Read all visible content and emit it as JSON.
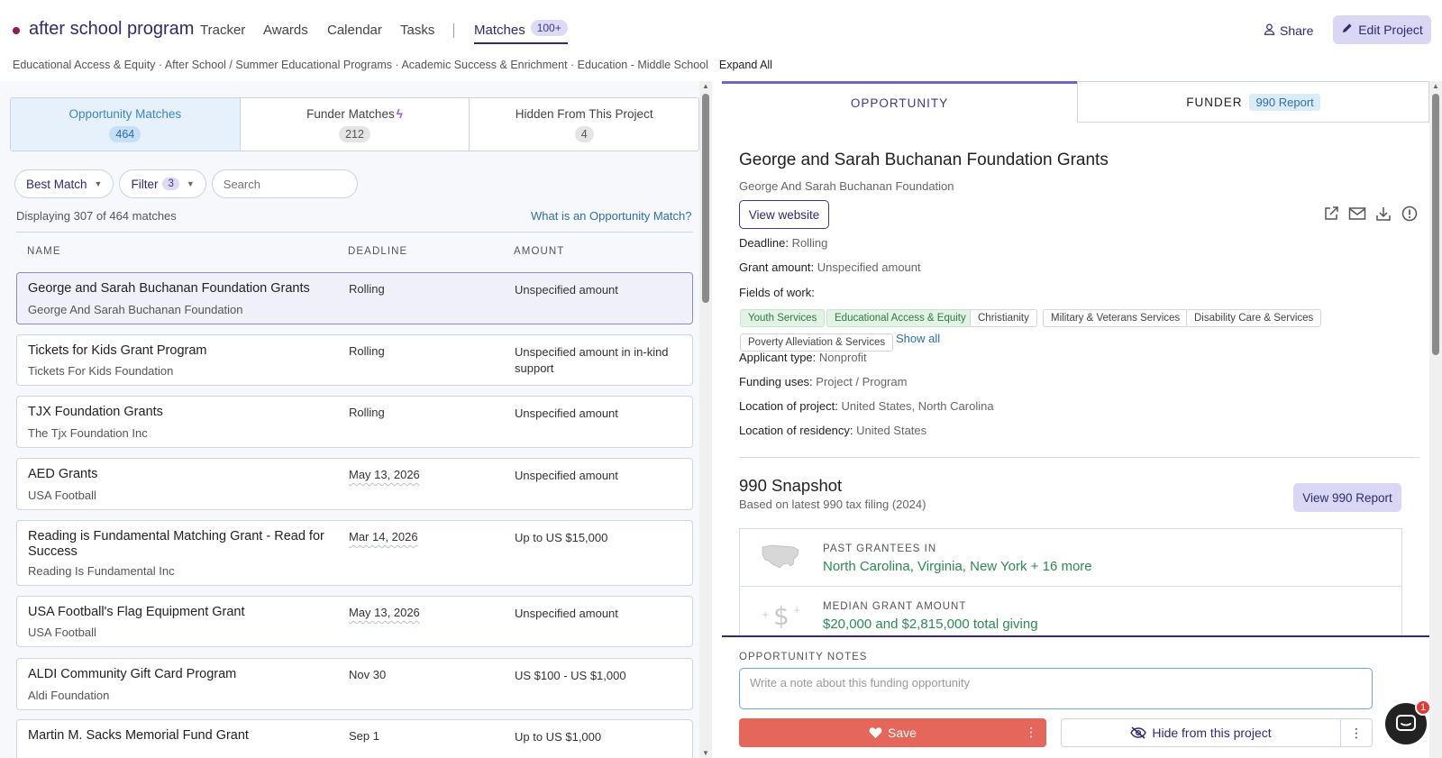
{
  "project": {
    "title": "after school program",
    "dot_color": "#8e1c55"
  },
  "nav": {
    "items": [
      "Tracker",
      "Awards",
      "Calendar",
      "Tasks"
    ],
    "active": {
      "label": "Matches",
      "badge": "100+"
    },
    "share_label": "Share",
    "edit_label": "Edit Project"
  },
  "breadcrumb": {
    "text": "Educational Access & Equity · After School / Summer Educational Programs · Academic Success & Enrichment · Education - Middle School",
    "expand_label": "Expand All"
  },
  "tabs": [
    {
      "label": "Opportunity Matches",
      "count": "464"
    },
    {
      "label": "Funder Matches",
      "count": "212"
    },
    {
      "label": "Hidden From This Project",
      "count": "4"
    }
  ],
  "controls": {
    "sort_label": "Best Match",
    "filter_label": "Filter",
    "filter_count": "3",
    "search_placeholder": "Search"
  },
  "list": {
    "display_text": "Displaying 307 of 464 matches",
    "what_link": "What is an Opportunity Match?",
    "headers": {
      "name": "NAME",
      "deadline": "DEADLINE",
      "amount": "AMOUNT"
    },
    "rows": [
      {
        "name": "George and Sarah Buchanan Foundation Grants",
        "funder": "George And Sarah Buchanan Foundation",
        "deadline": "Rolling",
        "amount": "Unspecified amount"
      },
      {
        "name": "Tickets for Kids Grant Program",
        "funder": "Tickets For Kids Foundation",
        "deadline": "Rolling",
        "amount": "Unspecified amount in in-kind support"
      },
      {
        "name": "TJX Foundation Grants",
        "funder": "The Tjx Foundation Inc",
        "deadline": "Rolling",
        "amount": "Unspecified amount"
      },
      {
        "name": "AED Grants",
        "funder": "USA Football",
        "deadline": "May 13, 2026",
        "amount": "Unspecified amount"
      },
      {
        "name": "Reading is Fundamental Matching Grant - Read for Success",
        "funder": "Reading Is Fundamental Inc",
        "deadline": "Mar 14, 2026",
        "amount": "Up to US $15,000"
      },
      {
        "name": "USA Football's Flag Equipment Grant",
        "funder": "USA Football",
        "deadline": "May 13, 2026",
        "amount": "Unspecified amount"
      },
      {
        "name": "ALDI Community Gift Card Program",
        "funder": "Aldi Foundation",
        "deadline": "Nov 30",
        "amount": "US $100 - US $1,000"
      },
      {
        "name": "Martin M. Sacks Memorial Fund Grant",
        "funder": "",
        "deadline": "Sep 1",
        "amount": "Up to US $1,000"
      }
    ]
  },
  "detail": {
    "tab_opportunity": "OPPORTUNITY",
    "tab_funder": "FUNDER",
    "tab_funder_badge": "990 Report",
    "title": "George and Sarah Buchanan Foundation Grants",
    "funder": "George And Sarah Buchanan Foundation",
    "view_website": "View website",
    "deadline_label": "Deadline:",
    "deadline_value": "Rolling",
    "amount_label": "Grant amount:",
    "amount_value": "Unspecified amount",
    "fields_label": "Fields of work:",
    "fields": [
      "Youth Services",
      "Educational Access & Equity",
      "Christianity",
      "Military & Veterans Services",
      "Disability Care & Services",
      "Poverty Alleviation & Services"
    ],
    "show_all": "Show all",
    "applicant_label": "Applicant type:",
    "applicant_value": "Nonprofit",
    "uses_label": "Funding uses:",
    "uses_value": "Project / Program",
    "location_label": "Location of project:",
    "location_value": "United States, North Carolina",
    "residency_label": "Location of residency:",
    "residency_value": "United States"
  },
  "snapshot": {
    "title": "990 Snapshot",
    "subtitle": "Based on latest 990 tax filing (2024)",
    "view_button": "View 990 Report",
    "items": [
      {
        "label": "PAST GRANTEES IN",
        "value": "North Carolina, Virginia, New York + 16 more"
      },
      {
        "label": "MEDIAN GRANT AMOUNT",
        "value": "$20,000 and $2,815,000 total giving"
      }
    ]
  },
  "notes": {
    "label": "OPPORTUNITY NOTES",
    "placeholder": "Write a note about this funding opportunity",
    "save_label": "Save",
    "hide_label": "Hide from this project"
  },
  "chat": {
    "badge": "1"
  },
  "colors": {
    "accent": "#2f2a72",
    "save": "#e5665a",
    "link": "#2c6fb0",
    "green": "#2c8a50"
  }
}
